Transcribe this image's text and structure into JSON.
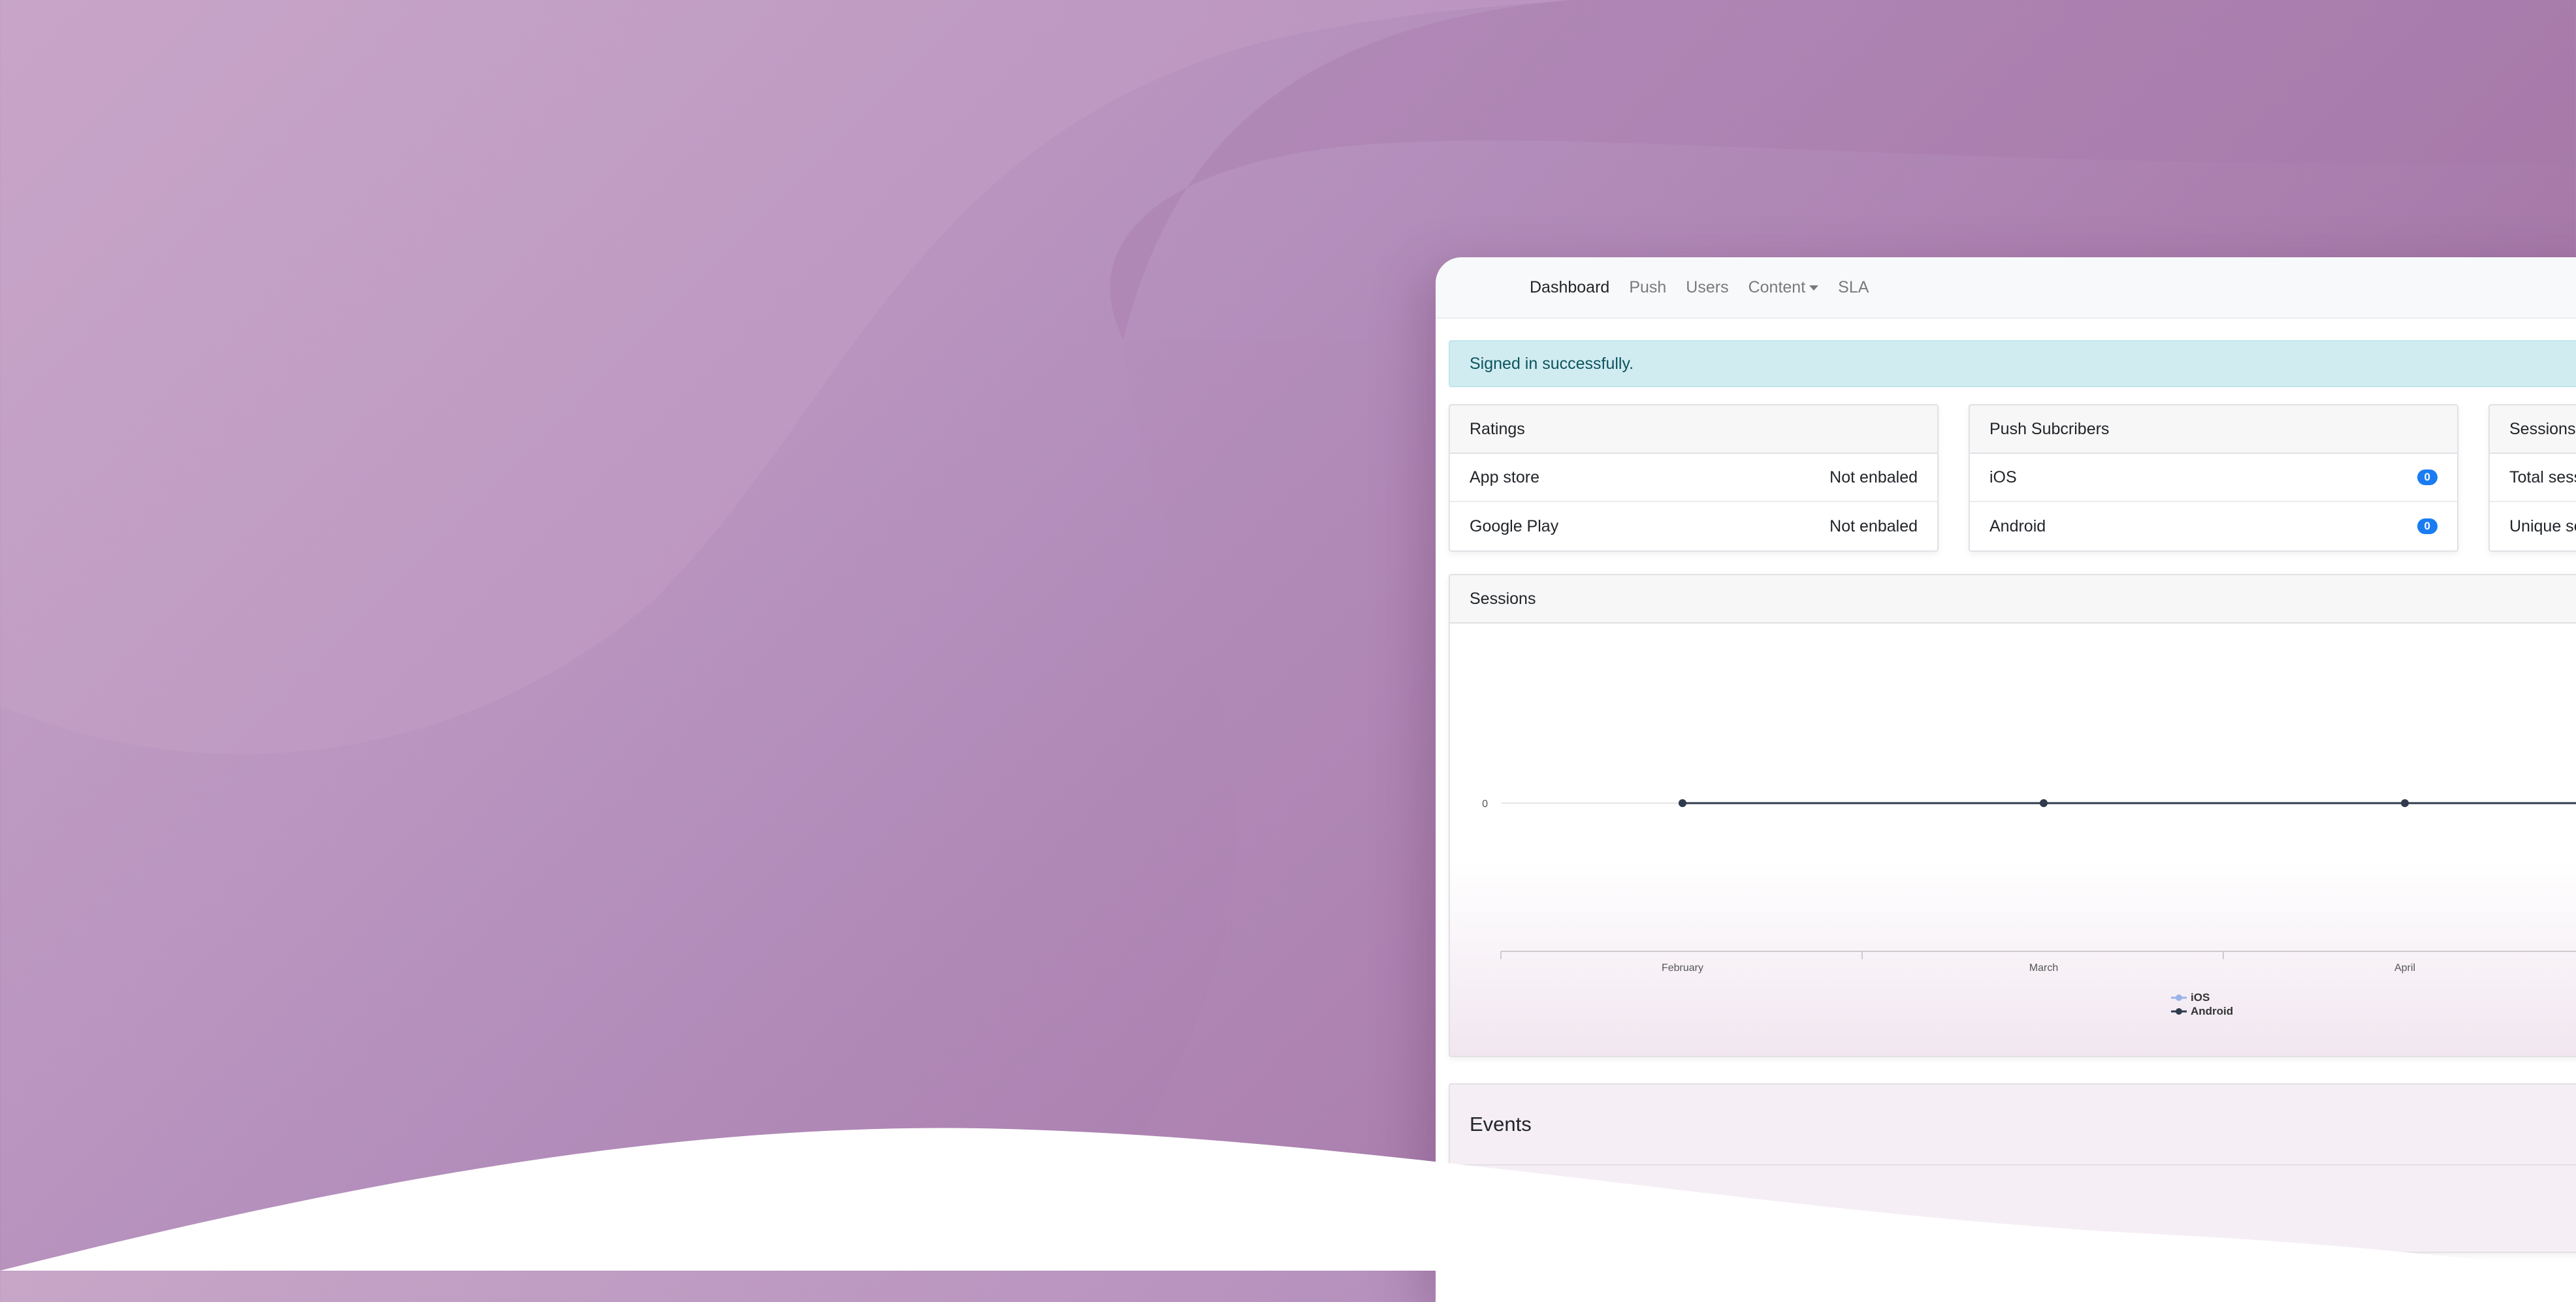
{
  "nav": {
    "items": [
      {
        "label": "Dashboard"
      },
      {
        "label": "Push"
      },
      {
        "label": "Users"
      },
      {
        "label": "Content"
      },
      {
        "label": "SLA"
      }
    ]
  },
  "alert": {
    "text": "Signed in successfully."
  },
  "ratings": {
    "title": "Ratings",
    "rows": [
      {
        "label": "App store",
        "value": "Not enbaled"
      },
      {
        "label": "Google Play",
        "value": "Not enbaled"
      }
    ]
  },
  "push": {
    "title": "Push Subcribers",
    "rows": [
      {
        "label": "iOS",
        "value": "0"
      },
      {
        "label": "Android",
        "value": "0"
      }
    ]
  },
  "sessions_card": {
    "title": "Sessions",
    "rows": [
      {
        "label": "Total sess"
      },
      {
        "label": "Unique se"
      }
    ]
  },
  "chart_data": {
    "type": "line",
    "title": "Sessions",
    "categories": [
      "February",
      "March",
      "April"
    ],
    "y_tick_labels": [
      "0"
    ],
    "series": [
      {
        "name": "iOS",
        "values": [
          0,
          0,
          0
        ],
        "color": "#9bb3e8"
      },
      {
        "name": "Android",
        "values": [
          0,
          0,
          0
        ],
        "color": "#2f3b4c"
      }
    ],
    "legend": "bottom-center"
  },
  "events": {
    "title": "Events"
  },
  "colors": {
    "accent": "#1a7cf2",
    "alert_bg": "#d1ecf1",
    "alert_text": "#0c5460"
  }
}
